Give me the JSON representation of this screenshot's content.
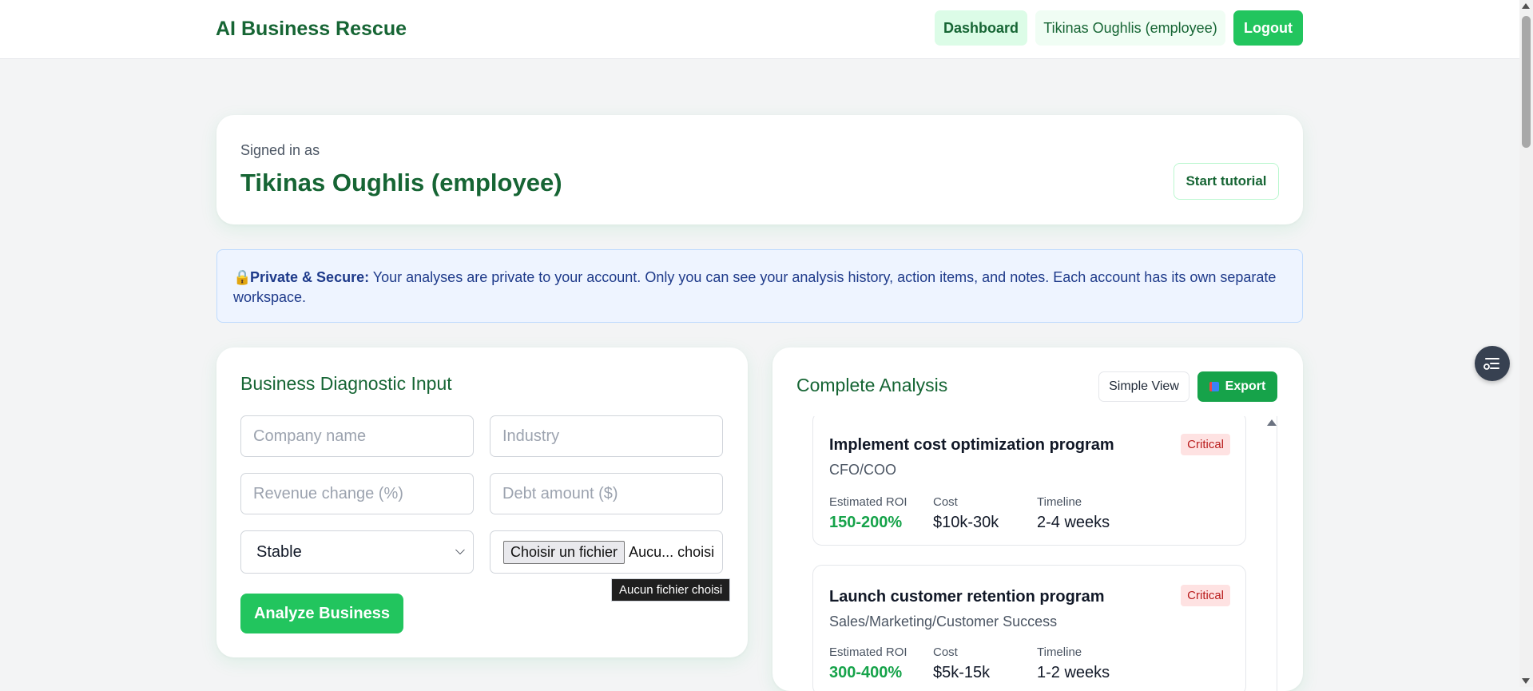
{
  "header": {
    "brand": "AI Business Rescue",
    "dashboard_label": "Dashboard",
    "user_label": "Tikinas Oughlis (employee)",
    "logout_label": "Logout"
  },
  "signed_in": {
    "label": "Signed in as",
    "name": "Tikinas Oughlis (employee)",
    "tutorial_label": "Start tutorial"
  },
  "privacy": {
    "icon": "lock-icon",
    "title": "Private & Secure:",
    "text": "Your analyses are private to your account. Only you can see your analysis history, action items, and notes. Each account has its own separate workspace."
  },
  "diagnostic": {
    "title": "Business Diagnostic Input",
    "company_placeholder": "Company name",
    "industry_placeholder": "Industry",
    "revenue_placeholder": "Revenue change (%)",
    "debt_placeholder": "Debt amount ($)",
    "trend_selected": "Stable",
    "file_button": "Choisir un fichier",
    "file_status": "Aucu... choisi",
    "file_tooltip": "Aucun fichier choisi",
    "analyze_label": "Analyze Business"
  },
  "analysis": {
    "title": "Complete Analysis",
    "simple_view_label": "Simple View",
    "export_label": "Export",
    "recommendations": [
      {
        "title": "Implement cost optimization program",
        "owner": "CFO/COO",
        "priority": "Critical",
        "roi_label": "Estimated ROI",
        "roi": "150-200%",
        "cost_label": "Cost",
        "cost": "$10k-30k",
        "timeline_label": "Timeline",
        "timeline": "2-4 weeks"
      },
      {
        "title": "Launch customer retention program",
        "owner": "Sales/Marketing/Customer Success",
        "priority": "Critical",
        "roi_label": "Estimated ROI",
        "roi": "300-400%",
        "cost_label": "Cost",
        "cost": "$5k-15k",
        "timeline_label": "Timeline",
        "timeline": "1-2 weeks"
      }
    ]
  },
  "colors": {
    "brand_green": "#166534",
    "accent_green": "#22c55e",
    "critical_bg": "#fee2e2",
    "critical_text": "#b91c1c"
  }
}
